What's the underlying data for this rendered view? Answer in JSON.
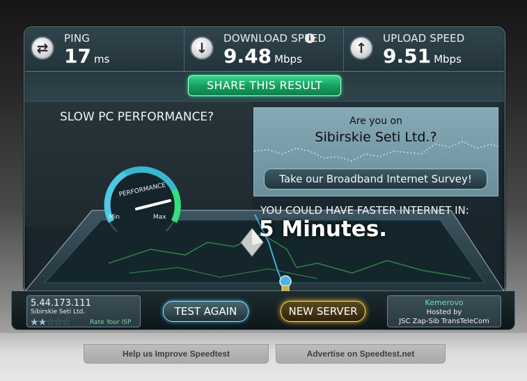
{
  "stats": {
    "ping": {
      "label": "PING",
      "value": "17",
      "unit": "ms",
      "icon": "swap-arrows-icon"
    },
    "download": {
      "label": "DOWNLOAD SPEED",
      "value": "9.48",
      "unit": "Mbps",
      "icon": "arrow-down-icon"
    },
    "upload": {
      "label": "UPLOAD SPEED",
      "value": "9.51",
      "unit": "Mbps",
      "icon": "arrow-up-icon"
    }
  },
  "share": {
    "label": "SHARE THIS RESULT"
  },
  "performance": {
    "title": "SLOW PC PERFORMANCE?",
    "gauge_label": "PERFORMANCE",
    "min_label": "Min",
    "max_label": "Max",
    "level": 0.85
  },
  "survey": {
    "line1": "Are you on",
    "line2": "Sibirskie Seti Ltd.?",
    "button": "Take our Broadband Internet Survey!"
  },
  "faster": {
    "label": "YOU COULD HAVE FASTER INTERNET IN:",
    "value": "5 Minutes."
  },
  "client": {
    "ip": "5.44.173.111",
    "isp": "Sibirskie Seti Ltd.",
    "rating": 2,
    "rating_max": 5,
    "rate_label": "Rate Your ISP"
  },
  "buttons": {
    "test_again": "TEST AGAIN",
    "new_server": "NEW SERVER"
  },
  "server": {
    "city": "Kemerovo",
    "hosted_by": "Hosted by",
    "host": "JSC Zap-Sib TransTeleCom"
  },
  "footer": {
    "help": "Help us Improve Speedtest",
    "advertise": "Advertise on Speedtest.net"
  },
  "colors": {
    "accent_green": "#1de08a",
    "accent_blue": "#2eb8e6",
    "accent_gold": "#f2b824"
  }
}
